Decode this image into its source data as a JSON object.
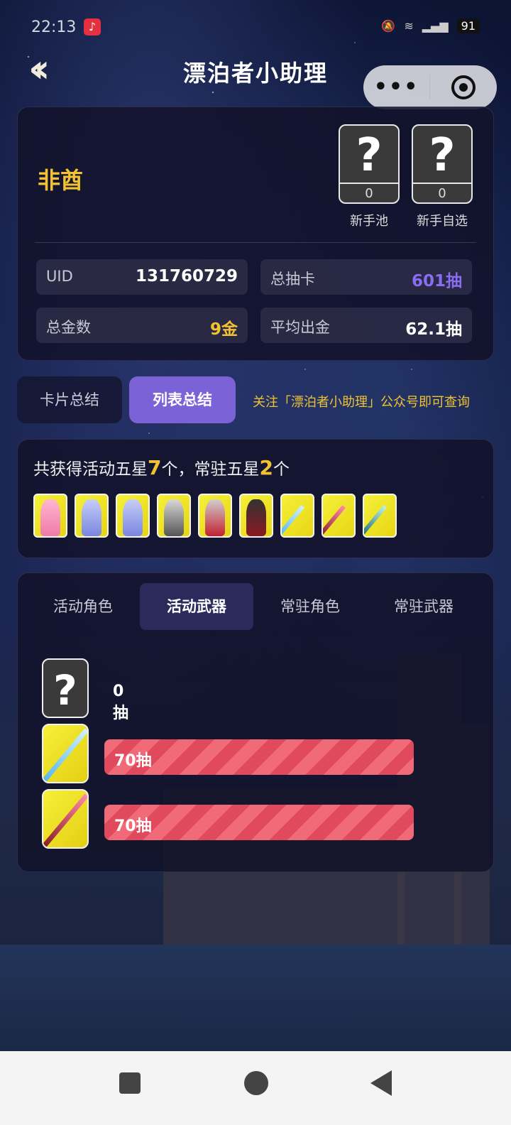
{
  "status": {
    "time": "22:13",
    "battery": "91"
  },
  "header": {
    "title": "漂泊者小助理",
    "more_label": "•••"
  },
  "profile": {
    "name": "非酋",
    "pools": [
      {
        "symbol": "?",
        "count": "0",
        "label": "新手池"
      },
      {
        "symbol": "?",
        "count": "0",
        "label": "新手自选"
      }
    ],
    "stats": {
      "uid_label": "UID",
      "uid_value": "131760729",
      "total_label": "总抽卡",
      "total_value": "601抽",
      "gold_label": "总金数",
      "gold_value": "9金",
      "avg_label": "平均出金",
      "avg_value": "62.1抽"
    },
    "colors": {
      "name": "#f2c233",
      "total": "#8a6cf0",
      "gold": "#f2c233"
    }
  },
  "summary_tabs": [
    {
      "label": "卡片总结",
      "active": false
    },
    {
      "label": "列表总结",
      "active": true
    }
  ],
  "tip": "关注「漂泊者小助理」公众号即可查询",
  "five_star": {
    "prefix": "共获得活动五星",
    "limited_count": "7",
    "middle": "个，常驻五星",
    "standard_count": "2",
    "suffix": "个",
    "items": [
      {
        "kind": "character",
        "icon": "pink-hair-character"
      },
      {
        "kind": "character",
        "icon": "blue-hair-character"
      },
      {
        "kind": "character",
        "icon": "blue-hair-character"
      },
      {
        "kind": "character",
        "icon": "silver-hair-character"
      },
      {
        "kind": "character",
        "icon": "red-dress-character"
      },
      {
        "kind": "character",
        "icon": "dark-hair-character"
      },
      {
        "kind": "weapon",
        "icon": "blue-blade-weapon"
      },
      {
        "kind": "weapon",
        "icon": "red-blade-weapon"
      },
      {
        "kind": "weapon",
        "icon": "teal-blade-weapon"
      }
    ]
  },
  "weapon_tabs": [
    {
      "label": "活动角色",
      "active": false
    },
    {
      "label": "活动武器",
      "active": true
    },
    {
      "label": "常驻角色",
      "active": false
    },
    {
      "label": "常驻武器",
      "active": false
    }
  ],
  "weapon_rows": [
    {
      "icon": "unknown",
      "symbol": "?",
      "pulls": "0抽",
      "bar": false
    },
    {
      "icon": "blue-blade-weapon",
      "pulls": "70抽",
      "bar": true
    },
    {
      "icon": "red-blade-weapon",
      "pulls": "70抽",
      "bar": true
    }
  ]
}
